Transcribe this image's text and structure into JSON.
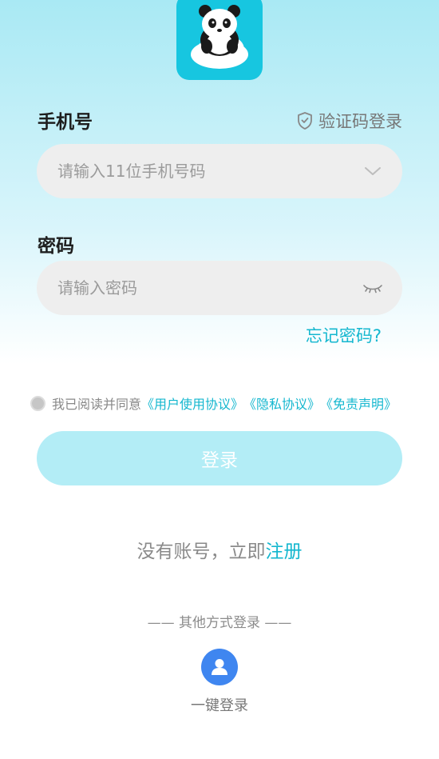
{
  "logo": {
    "icon": "panda-icon",
    "color": "#17c6e0"
  },
  "phone": {
    "label": "手机号",
    "placeholder": "请输入11位手机号码",
    "dropdown_icon": "chevron-down-icon"
  },
  "sms_login": {
    "icon": "shield-check-icon",
    "label": "验证码登录"
  },
  "password": {
    "label": "密码",
    "placeholder": "请输入密码",
    "toggle_icon": "eye-closed-icon"
  },
  "forgot": {
    "label": "忘记密码?"
  },
  "agreement": {
    "text": "我已阅读并同意",
    "links": [
      "《用户使用协议》",
      "《隐私协议》",
      "《免责声明》"
    ],
    "checked": false
  },
  "login_button": {
    "label": "登录"
  },
  "register": {
    "text": "没有账号，立即",
    "link": "注册"
  },
  "other_login": {
    "title": "—— 其他方式登录 ——",
    "onekey": {
      "icon": "user-icon",
      "label": "一键登录"
    }
  },
  "colors": {
    "accent": "#14b7cf",
    "button_disabled": "#b3edf6",
    "onekey": "#3f86f0"
  }
}
